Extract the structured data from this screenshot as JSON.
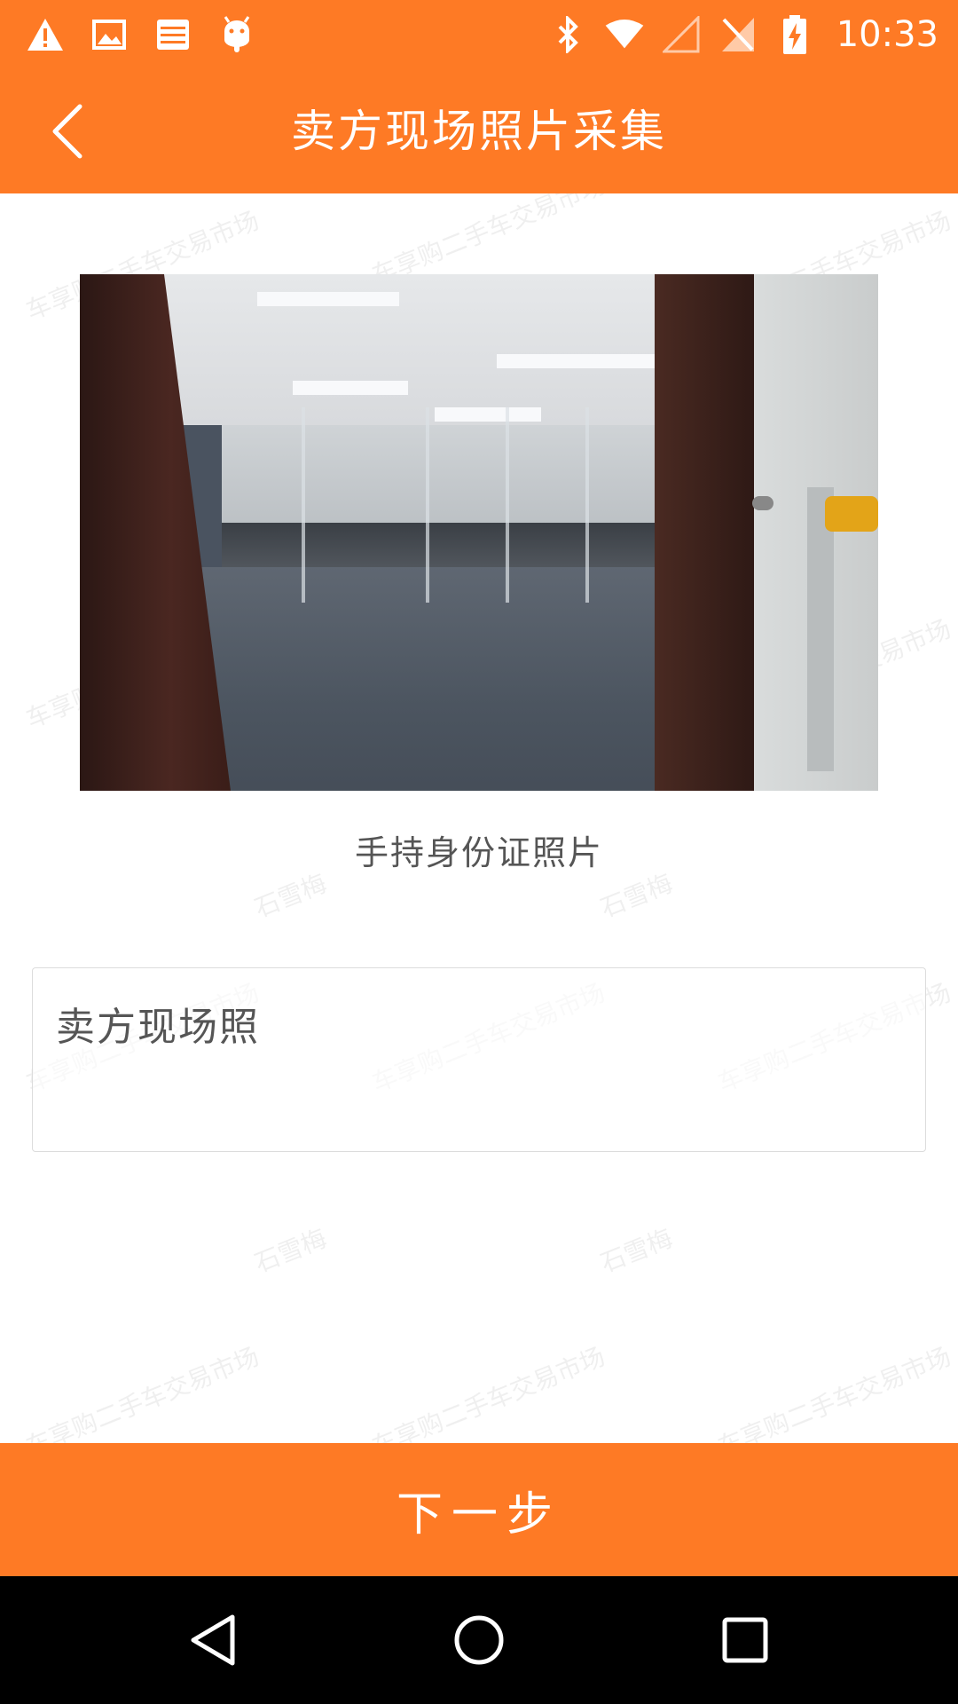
{
  "status_bar": {
    "time": "10:33",
    "left_icons": [
      "warning-icon",
      "image-icon",
      "storage-icon",
      "android-icon"
    ],
    "right_icons": [
      "bluetooth-icon",
      "wifi-icon",
      "signal-icon",
      "no-sim-icon",
      "battery-charging-icon"
    ]
  },
  "header": {
    "title": "卖方现场照片采集",
    "back_icon": "chevron-left-icon"
  },
  "photo": {
    "caption": "手持身份证照片"
  },
  "remark": {
    "value": "卖方现场照"
  },
  "footer": {
    "next_label": "下一步"
  },
  "watermark": {
    "line1": "车享购二手车交易市场",
    "line2": "石雪梅"
  },
  "nav_bar": {
    "icons": [
      "back-triangle-icon",
      "home-circle-icon",
      "recents-square-icon"
    ]
  },
  "colors": {
    "accent": "#FE7A25",
    "nav_background": "#000000"
  }
}
